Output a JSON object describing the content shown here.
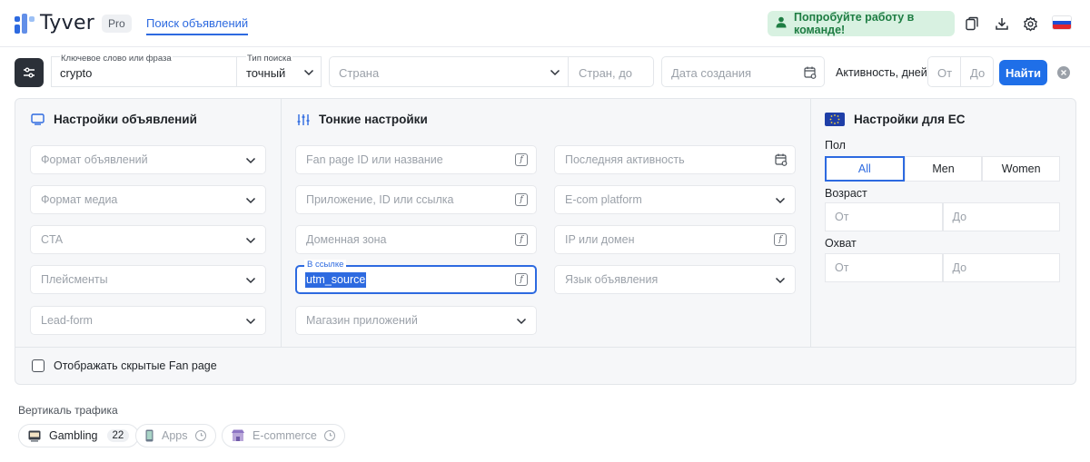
{
  "header": {
    "logo_text": "Tyver",
    "pro_badge": "Pro",
    "nav_link": "Поиск объявлений",
    "team_button": "Попробуйте работу в команде!"
  },
  "search": {
    "keyword_label": "Ключевое слово или фраза",
    "keyword_value": "crypto",
    "type_label": "Тип поиска",
    "type_value": "точный",
    "country_placeholder": "Страна",
    "countries_to_placeholder": "Стран, до",
    "created_placeholder": "Дата создания",
    "activity_label": "Активность, дней",
    "from_placeholder": "От",
    "to_placeholder": "До",
    "find_button": "Найти"
  },
  "ad_settings": {
    "title": "Настройки объявлений",
    "fields": [
      "Формат объявлений",
      "Формат медиа",
      "CTA",
      "Плейсменты",
      "Lead-form"
    ]
  },
  "fine_settings": {
    "title": "Тонкие настройки",
    "left_fields": [
      "Fan page ID или название",
      "Приложение, ID или ссылка",
      "Доменная зона"
    ],
    "link_label": "В ссылке",
    "link_value": "utm_source",
    "store_field": "Магазин приложений",
    "right_fields": [
      "Последняя активность",
      "E-com platform",
      "IP или домен",
      "Язык объявления"
    ]
  },
  "eu_settings": {
    "title": "Настройки для ЕС",
    "gender_label": "Пол",
    "gender_options": [
      "All",
      "Men",
      "Women"
    ],
    "age_label": "Возраст",
    "reach_label": "Охват",
    "from": "От",
    "to": "До"
  },
  "hidden_fanpage_label": "Отображать скрытые Fan page",
  "traffic": {
    "title": "Вертикаль трафика",
    "chips": [
      {
        "label": "Gambling",
        "count": "22"
      },
      {
        "label": "Apps"
      },
      {
        "label": "E-commerce"
      }
    ]
  },
  "colors": {
    "accent": "#1f6fe8",
    "team_bg": "#d8f1e1",
    "team_text": "#1e7d43"
  }
}
